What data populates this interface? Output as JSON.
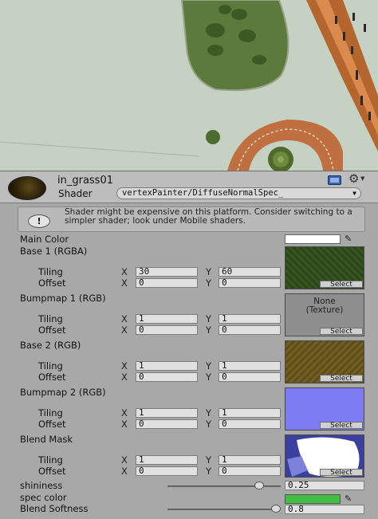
{
  "material": {
    "name": "in_grass01",
    "shader_label": "Shader",
    "shader_value": "vertexPainter/DiffuseNormalSpec_",
    "icons": {
      "thumbnail": "material-sphere-icon",
      "help": "book-icon",
      "settings": "gear-icon"
    }
  },
  "warning": {
    "icon": "info-icon",
    "icon_glyph": "!",
    "text": "Shader might be expensive on this platform. Consider switching to a simpler shader; look under Mobile shaders."
  },
  "properties": {
    "main_color": {
      "label": "Main Color",
      "color": "#ffffff"
    },
    "textures": [
      {
        "label": "Base 1 (RGBA)",
        "tiling_label": "Tiling",
        "offset_label": "Offset",
        "tiling_x": "30",
        "tiling_y": "60",
        "offset_x": "0",
        "offset_y": "0",
        "select": "Select",
        "preview": "green-grass",
        "color": "#2f4a1c"
      },
      {
        "label": "Bumpmap 1 (RGB)",
        "tiling_label": "Tiling",
        "offset_label": "Offset",
        "tiling_x": "1",
        "tiling_y": "1",
        "offset_x": "0",
        "offset_y": "0",
        "select": "Select",
        "preview": "none",
        "none_text_1": "None",
        "none_text_2": "(Texture)"
      },
      {
        "label": "Base 2 (RGB)",
        "tiling_label": "Tiling",
        "offset_label": "Offset",
        "tiling_x": "1",
        "tiling_y": "1",
        "offset_x": "0",
        "offset_y": "0",
        "select": "Select",
        "preview": "dirt",
        "color": "#6b5a1e"
      },
      {
        "label": "Bumpmap 2 (RGB)",
        "tiling_label": "Tiling",
        "offset_label": "Offset",
        "tiling_x": "1",
        "tiling_y": "1",
        "offset_x": "0",
        "offset_y": "0",
        "select": "Select",
        "preview": "normal-map",
        "color": "#7f7fff"
      },
      {
        "label": "Blend Mask",
        "tiling_label": "Tiling",
        "offset_label": "Offset",
        "tiling_x": "1",
        "tiling_y": "1",
        "offset_x": "0",
        "offset_y": "0",
        "select": "Select",
        "preview": "mask"
      }
    ],
    "axis_x": "X",
    "axis_y": "Y",
    "shininess": {
      "label": "shininess",
      "value": "0.25",
      "fraction": 0.81
    },
    "spec_color": {
      "label": "spec color",
      "color": "#3fbf3f"
    },
    "blend_softness": {
      "label": "Blend Softness",
      "value": "0.8",
      "fraction": 0.96
    }
  }
}
